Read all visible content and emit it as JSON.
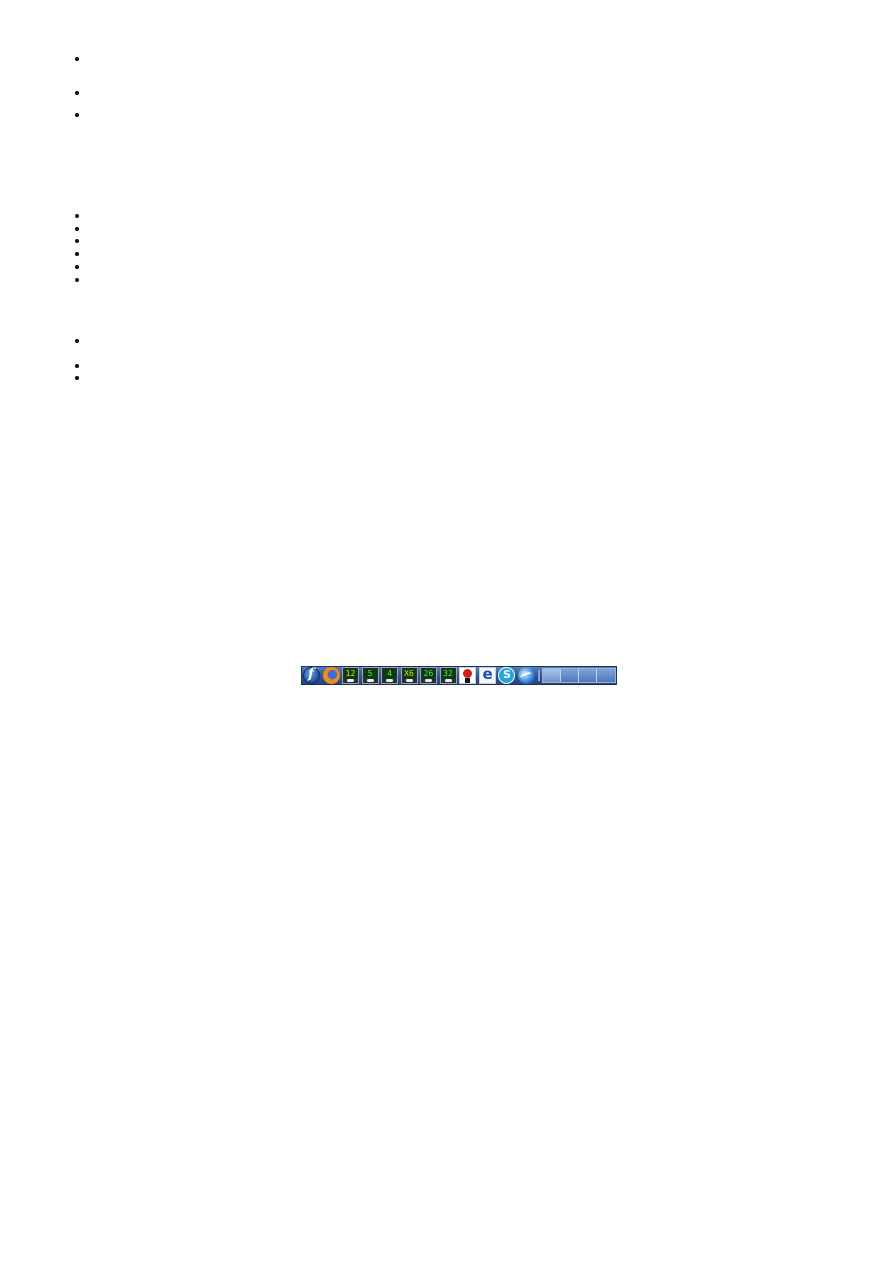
{
  "taskbar": {
    "launchers": [
      {
        "name": "fedora-icon"
      },
      {
        "name": "firefox-icon"
      },
      {
        "name": "workspace-monitor-icon",
        "label": "12"
      },
      {
        "name": "workspace-monitor-icon",
        "label": "5"
      },
      {
        "name": "workspace-monitor-icon",
        "label": "4"
      },
      {
        "name": "workspace-monitor-icon",
        "label": "X6"
      },
      {
        "name": "workspace-monitor-icon",
        "label": "26"
      },
      {
        "name": "workspace-monitor-icon",
        "label": "32"
      },
      {
        "name": "red-app-icon"
      },
      {
        "name": "e-app-icon"
      },
      {
        "name": "skype-icon"
      },
      {
        "name": "globe-icon"
      }
    ],
    "pager": {
      "workspaces": 4,
      "active_index": 0
    }
  },
  "colors": {
    "taskbar_background": "#2f5390",
    "page_background": "#ffffff",
    "bullet": "#111111"
  }
}
